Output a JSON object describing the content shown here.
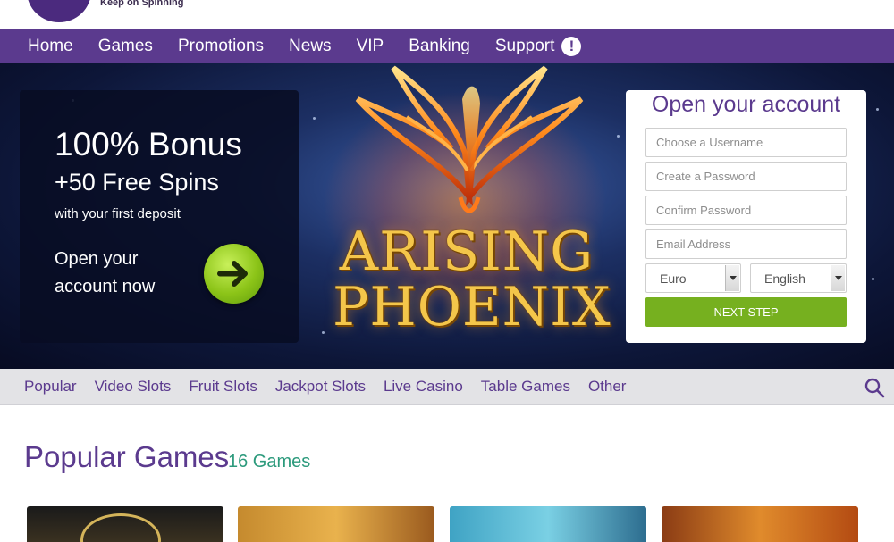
{
  "brand": {
    "tagline": "Keep on Spinning"
  },
  "nav": {
    "items": [
      "Home",
      "Games",
      "Promotions",
      "News",
      "VIP",
      "Banking"
    ],
    "support_label": "Support",
    "support_icon": "alert-icon"
  },
  "hero": {
    "bonus_title": "100% Bonus",
    "bonus_subtitle": "+50 Free Spins",
    "bonus_note": "with your first deposit",
    "cta_text": "Open your account now",
    "cta_icon": "arrow-right-icon",
    "game_logo_line1": "ARISING",
    "game_logo_line2": "PHOENIX"
  },
  "signup": {
    "title": "Open your account",
    "username_placeholder": "Choose a Username",
    "password_placeholder": "Create a Password",
    "confirm_placeholder": "Confirm Password",
    "email_placeholder": "Email Address",
    "currency_value": "Euro",
    "language_value": "English",
    "submit_label": "NEXT STEP"
  },
  "categories": {
    "items": [
      "Popular",
      "Video Slots",
      "Fruit Slots",
      "Jackpot Slots",
      "Live Casino",
      "Table Games",
      "Other"
    ],
    "search_icon": "search-icon"
  },
  "popular": {
    "title": "Popular Games",
    "count": "16 Games"
  },
  "colors": {
    "brand_purple": "#5b3a8e",
    "accent_green": "#76b01f",
    "count_teal": "#2c9a7c"
  }
}
